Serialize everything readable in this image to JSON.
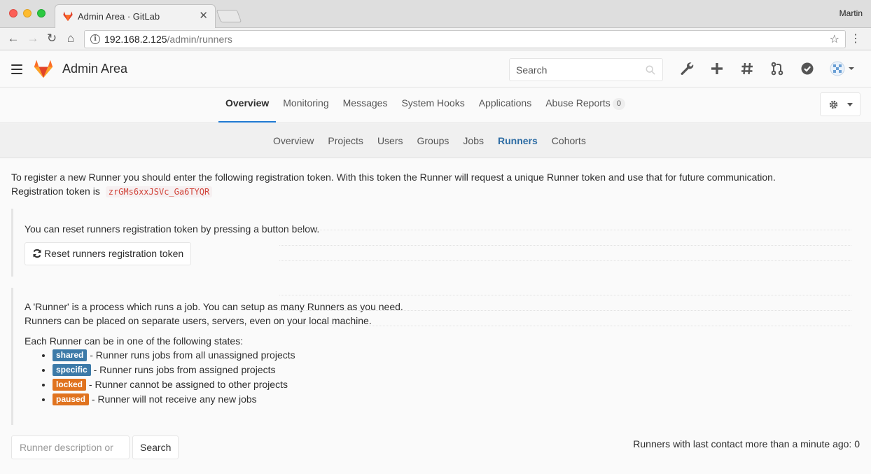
{
  "browser": {
    "tab_title": "Admin Area · GitLab",
    "tab_close": "✕",
    "profile_name": "Martin",
    "url_host": "192.168.2.125",
    "url_path": "/admin/runners"
  },
  "header": {
    "title": "Admin Area",
    "search_placeholder": "Search",
    "brand_color": "#e24329"
  },
  "top_nav": {
    "items": [
      {
        "label": "Overview"
      },
      {
        "label": "Monitoring"
      },
      {
        "label": "Messages"
      },
      {
        "label": "System Hooks"
      },
      {
        "label": "Applications"
      },
      {
        "label": "Abuse Reports"
      }
    ],
    "abuse_count": "0",
    "active": "Overview"
  },
  "sub_nav": {
    "items": [
      {
        "label": "Overview"
      },
      {
        "label": "Projects"
      },
      {
        "label": "Users"
      },
      {
        "label": "Groups"
      },
      {
        "label": "Jobs"
      },
      {
        "label": "Runners"
      },
      {
        "label": "Cohorts"
      }
    ],
    "active": "Runners"
  },
  "content": {
    "intro_line1": "To register a new Runner you should enter the following registration token. With this token the Runner will request a unique Runner token and use that for future communication.",
    "intro_line2_prefix": "Registration token is",
    "registration_token": "zrGMs6xxJSVc_Ga6TYQR",
    "reset_hint": "You can reset runners registration token by pressing a button below.",
    "reset_button": "Reset runners registration token",
    "runner_desc_line1": "A 'Runner' is a process which runs a job. You can setup as many Runners as you need.",
    "runner_desc_line2": "Runners can be placed on separate users, servers, even on your local machine.",
    "states_heading": "Each Runner can be in one of the following states:",
    "states": [
      {
        "label": "shared",
        "text": " - Runner runs jobs from all unassigned projects",
        "color": "#3c7aa8"
      },
      {
        "label": "specific",
        "text": " - Runner runs jobs from assigned projects",
        "color": "#3c7aa8"
      },
      {
        "label": "locked",
        "text": " - Runner cannot be assigned to other projects",
        "color": "#e0731f"
      },
      {
        "label": "paused",
        "text": " - Runner will not receive any new jobs",
        "color": "#e0731f"
      }
    ],
    "filter_placeholder": "Runner description or",
    "search_button": "Search",
    "last_contact": "Runners with last contact more than a minute ago: 0"
  }
}
